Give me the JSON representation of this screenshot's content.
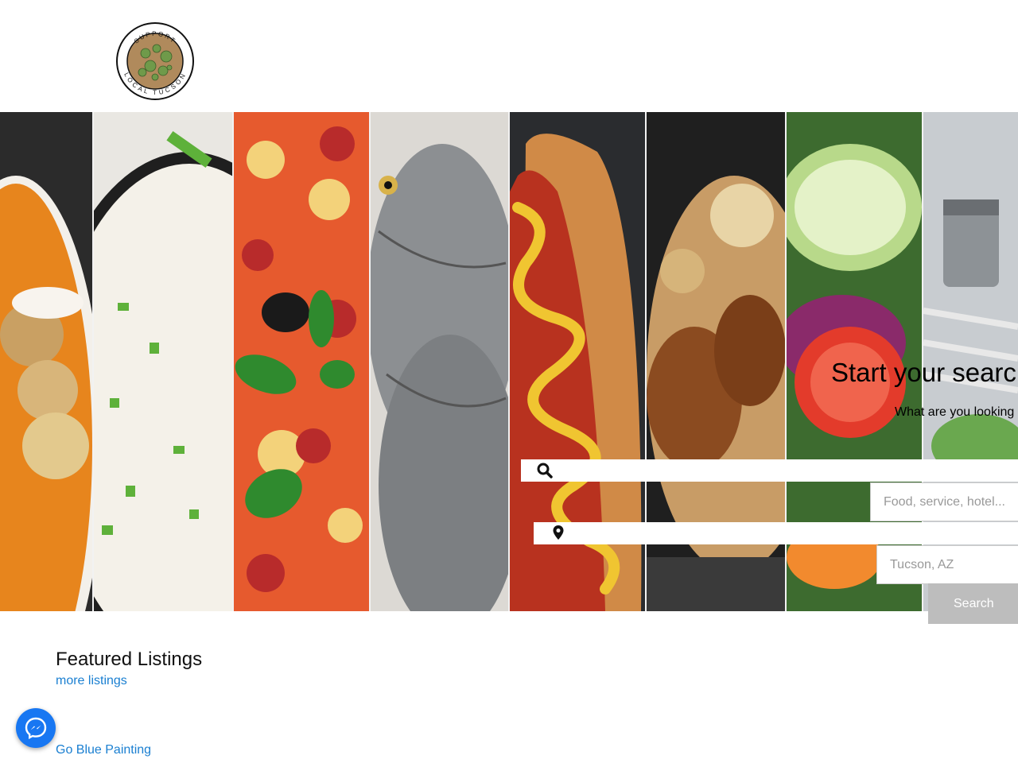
{
  "logo": {
    "text_top": "SUPPORT",
    "text_bottom": "LOCAL TUCSON",
    "icon": "cactus-logo-icon"
  },
  "hero": {
    "images": [
      "soup",
      "rice",
      "pizza",
      "fish",
      "hot-dog",
      "grilled-meat",
      "salad",
      "table-setting"
    ],
    "title": "Start your search",
    "subtitle": "What are you looking",
    "search_icon": "search-icon",
    "location_icon": "map-pin-icon",
    "what_placeholder": "Food, service, hotel...",
    "where_placeholder": "Tucson, AZ",
    "search_button": "Search"
  },
  "featured": {
    "title": "Featured Listings",
    "more_label": "more listings",
    "listings": [
      "Go Blue Painting"
    ]
  },
  "chat": {
    "icon": "messenger-icon"
  },
  "colors": {
    "link": "#1a7fd1",
    "button": "#bdbdbd",
    "messenger": "#1877f2"
  }
}
